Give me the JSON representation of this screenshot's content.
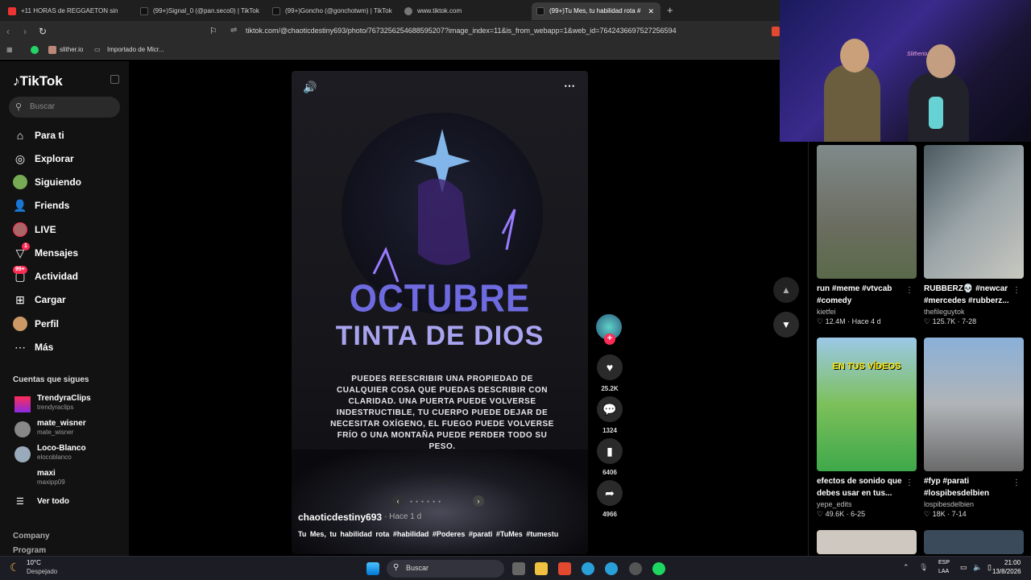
{
  "browser": {
    "tabs": [
      {
        "label": "+11 HORAS de REGGAETON sin"
      },
      {
        "label": "(99+)Signal_0 (@pan.seco0) | TikTok"
      },
      {
        "label": "(99+)Goncho (@gonchotwm) | TikTok"
      },
      {
        "label": "www.tiktok.com"
      },
      {
        "label": "(99+)Tu Mes, tu habilidad rota #"
      }
    ],
    "url": "tiktok.com/@chaoticdestiny693/photo/7673256254688595207?image_index=11&is_from_webapp=1&web_id=7642436697527256594",
    "bookmarks": [
      {
        "label": "slither.io"
      },
      {
        "label": "Importado de Micr..."
      }
    ]
  },
  "sidebar": {
    "logo": "TikTok",
    "search_placeholder": "Buscar",
    "nav": [
      {
        "label": "Para ti"
      },
      {
        "label": "Explorar"
      },
      {
        "label": "Siguiendo"
      },
      {
        "label": "Friends"
      },
      {
        "label": "LIVE"
      },
      {
        "label": "Mensajes",
        "badge": "1"
      },
      {
        "label": "Actividad",
        "badge": "99+"
      },
      {
        "label": "Cargar"
      },
      {
        "label": "Perfil"
      },
      {
        "label": "Más"
      }
    ],
    "following_title": "Cuentas que sigues",
    "accounts": [
      {
        "name": "TrendyraClips",
        "handle": "trendyraclips"
      },
      {
        "name": "mate_wisner",
        "handle": "mate_wisner"
      },
      {
        "name": "Loco-Blanco",
        "handle": "elocoblanco"
      },
      {
        "name": "maxi",
        "handle": "maxipp09"
      }
    ],
    "see_all": "Ver todo",
    "footer": [
      "Company",
      "Program"
    ]
  },
  "post": {
    "headline1": "OCTUBRE",
    "headline2": "TINTA DE DIOS",
    "body": "PUEDES REESCRIBIR UNA PROPIEDAD DE CUALQUIER COSA QUE PUEDAS DESCRIBIR CON CLARIDAD. UNA PUERTA PUEDE VOLVERSE INDESTRUCTIBLE, TU CUERPO PUEDE DEJAR DE NECESITAR OXÍGENO, EL FUEGO PUEDE VOLVERSE FRÍO O UNA MONTAÑA PUEDE PERDER TODO SU PESO.",
    "author": "chaoticdestiny693",
    "time": "· Hace 1 d",
    "caption": "Tu Mes, tu habilidad rota #habilidad #Poderes #parati #TuMes #tumestu",
    "likes": "25.2K",
    "comments": "1324",
    "saves": "6406",
    "shares": "4966"
  },
  "webcam": {
    "sign": "Slitherio"
  },
  "related": [
    {
      "title": "run #meme #vtvcab #comedy",
      "author": "kietfei",
      "stats": "♡ 12.4M · Hace 4 d"
    },
    {
      "title": "RUBBERZ💀 #newcar #mercedes #rubberz...",
      "author": "thefileguytok",
      "stats": "♡ 125.7K · 7-28"
    },
    {
      "title": "efectos de sonido que debes usar en tus...",
      "author": "yepe_edits",
      "stats": "♡ 49.6K · 6-25",
      "overlay": "EN TUS VÍDEOS"
    },
    {
      "title": "#fyp #parati #lospibesdelbien",
      "author": "lospibesdelbien",
      "stats": "♡ 18K · 7-14"
    }
  ],
  "taskbar": {
    "weather_temp": "10°C",
    "weather_desc": "Despejado",
    "search": "Buscar",
    "lang1": "ESP",
    "lang2": "LAA",
    "time": "21:00",
    "date": "13/8/2026"
  }
}
